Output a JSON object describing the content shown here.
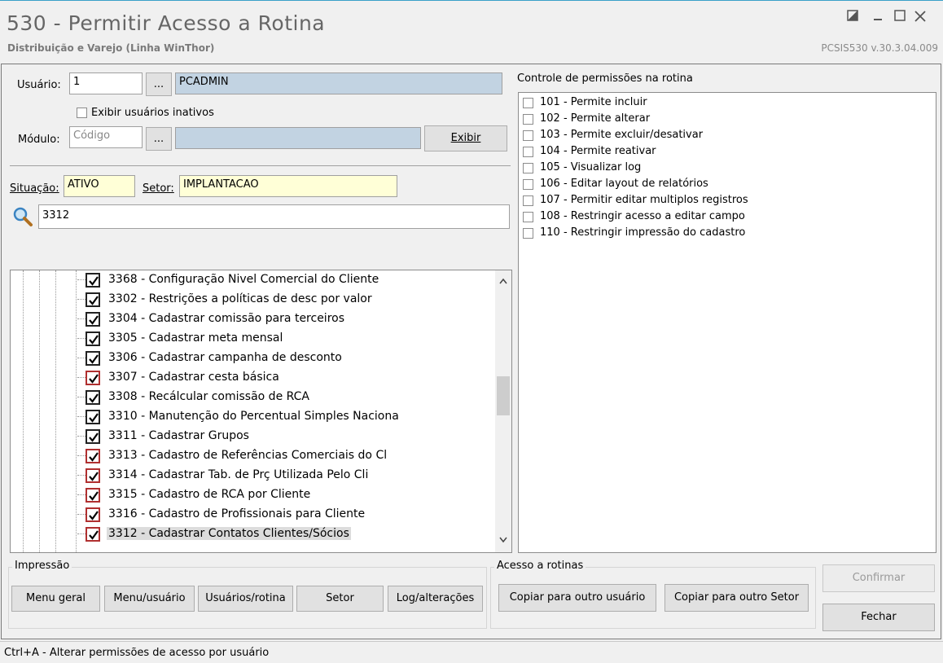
{
  "window": {
    "title": "530 - Permitir Acesso a Rotina",
    "subtitle": "Distribuição e Varejo (Linha WinThor)",
    "version": "PCSIS530  v.30.3.04.009"
  },
  "form": {
    "usuario_label": "Usuário:",
    "usuario_code": "1",
    "usuario_lookup": "...",
    "usuario_name": "PCADMIN",
    "inativos_label": "Exibir usuários inativos",
    "modulo_label": "Módulo:",
    "modulo_placeholder": "Código",
    "modulo_lookup": "...",
    "modulo_name": "",
    "exibir_label": "Exibir",
    "situacao_label": "Situação:",
    "situacao_value": "ATIVO",
    "setor_label": "Setor:",
    "setor_value": "IMPLANTACAO",
    "search_value": "3312"
  },
  "tree": {
    "items": [
      {
        "label": "3368 - Configuração Nivel Comercial do Cliente",
        "style": "black"
      },
      {
        "label": "3302 - Restrições a políticas de desc por valor",
        "style": "black"
      },
      {
        "label": "3304 - Cadastrar comissão para terceiros",
        "style": "black"
      },
      {
        "label": "3305 - Cadastrar meta mensal",
        "style": "black"
      },
      {
        "label": "3306 - Cadastrar campanha de desconto",
        "style": "black"
      },
      {
        "label": "3307 - Cadastrar cesta básica",
        "style": "red"
      },
      {
        "label": "3308 - Recálcular comissão de RCA",
        "style": "black"
      },
      {
        "label": "3310 - Manutenção do Percentual Simples Naciona",
        "style": "black"
      },
      {
        "label": "3311 - Cadastrar Grupos",
        "style": "black"
      },
      {
        "label": "3313 - Cadastro de Referências Comerciais do Cl",
        "style": "red"
      },
      {
        "label": "3314 - Cadastrar Tab. de Prç Utilizada Pelo Cli",
        "style": "red"
      },
      {
        "label": "3315 - Cadastro de RCA por Cliente",
        "style": "red"
      },
      {
        "label": "3316 - Cadastro de Profissionais para Cliente",
        "style": "red"
      },
      {
        "label": "3312 - Cadastrar Contatos Clientes/Sócios",
        "style": "red"
      }
    ]
  },
  "permissions": {
    "title": "Controle de permissões na rotina",
    "items": [
      "101 - Permite incluir",
      "102 - Permite alterar",
      "103 - Permite excluir/desativar",
      "104 - Permite reativar",
      "105 - Visualizar log",
      "106 - Editar layout de relatórios",
      "107 - Permitir editar multiplos registros",
      "108 - Restringir acesso a editar campo",
      "110 - Restringir impressão do cadastro"
    ]
  },
  "impressao": {
    "label": "Impressão",
    "buttons": [
      "Menu geral",
      "Menu/usuário",
      "Usuários/rotina",
      "Setor",
      "Log/alterações"
    ]
  },
  "acesso": {
    "label": "Acesso a rotinas",
    "buttons": [
      "Copiar para outro usuário",
      "Copiar para outro Setor"
    ]
  },
  "actions": {
    "confirmar": "Confirmar",
    "fechar": "Fechar"
  },
  "status": "Ctrl+A - Alterar permissões de acesso por usuário"
}
